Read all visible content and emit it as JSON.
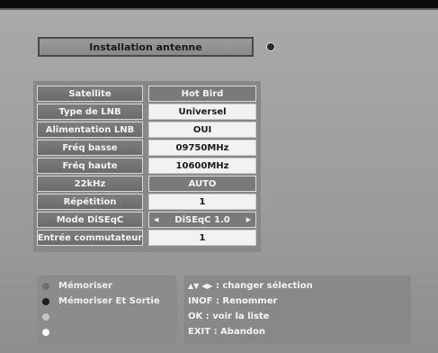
{
  "title": "Installation antenne",
  "rows": [
    {
      "label": "Satellite",
      "value": "Hot Bird"
    },
    {
      "label": "Type de LNB",
      "value": "Universel"
    },
    {
      "label": "Alimentation LNB",
      "value": "OUI"
    },
    {
      "label": "Fréq basse",
      "value": "09750MHz"
    },
    {
      "label": "Fréq haute",
      "value": "10600MHz"
    },
    {
      "label": "22kHz",
      "value": "AUTO"
    },
    {
      "label": "Répétition",
      "value": "1"
    },
    {
      "label": "Mode DiSEqC",
      "value": "DiSEqC 1.0"
    },
    {
      "label": "Entrée commutateur",
      "value": "1"
    }
  ],
  "legend": [
    {
      "label": "Mémoriser",
      "color": "#6e6e6e"
    },
    {
      "label": "Mémoriser  Et Sortie",
      "color": "#1e1e1e"
    },
    {
      "label": "",
      "color": "#c4c4c4"
    },
    {
      "label": "",
      "color": "#ffffff"
    }
  ],
  "help": [
    {
      "keys": "▲▼ ◀▶",
      "text": ": changer sélection"
    },
    {
      "keys": "",
      "text": "INOF : Renommer"
    },
    {
      "keys": "",
      "text": "OK : voir la liste"
    },
    {
      "keys": "",
      "text": "EXIT : Abandon"
    }
  ],
  "icons": {
    "left_arrow": "◀",
    "right_arrow": "▶"
  }
}
